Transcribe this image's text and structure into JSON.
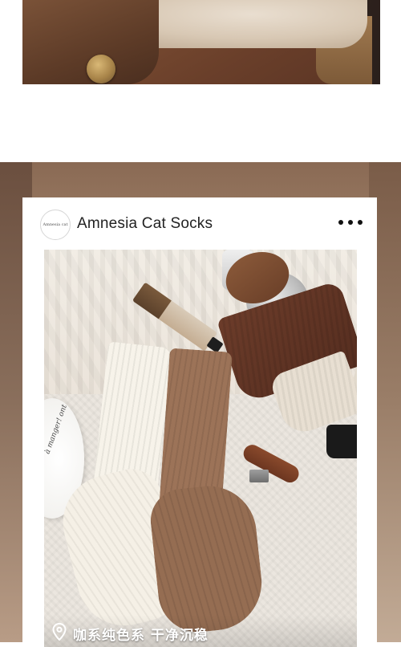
{
  "post": {
    "avatar_text": "Amnesia cat",
    "account_name": "Amnesia Cat Socks",
    "location": "咖系纯色系 干净沉稳"
  },
  "plate_text": "à manger! ont",
  "colors": {
    "card_background": "#ffffff",
    "name_text": "#222222",
    "more_dots": "#111111",
    "caption_text": "#ffffff"
  },
  "icons": [
    "more-icon",
    "location-pin-icon"
  ]
}
